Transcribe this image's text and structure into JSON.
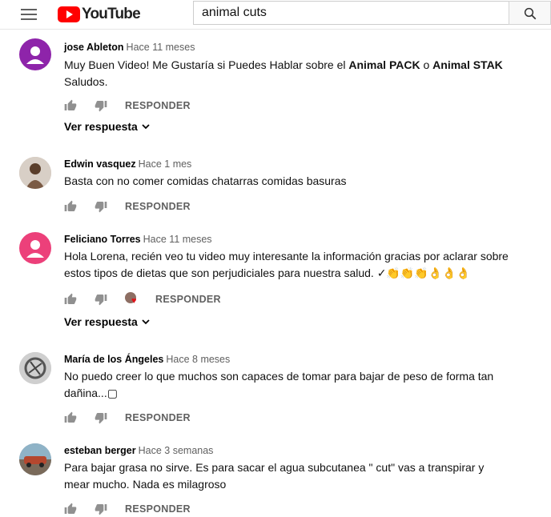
{
  "header": {
    "logo_text": "YouTube",
    "search_value": "animal cuts"
  },
  "colors": {
    "brand": "#ff0000",
    "reply_text": "#606060"
  },
  "comments": [
    {
      "author": "jose Ableton",
      "time": "Hace 11 meses",
      "text_before": "Muy Buen Video! Me Gustaría si Puedes Hablar sobre el ",
      "bold_1": "Animal PACK",
      "text_mid": " o ",
      "bold_2": "Animal STAK",
      "text_after": " Saludos.",
      "reply_label": "RESPONDER",
      "replies_label": "Ver respuesta"
    },
    {
      "author": "Edwin vasquez",
      "time": "Hace 1 mes",
      "text": "Basta con no comer comidas chatarras comidas basuras",
      "reply_label": "RESPONDER"
    },
    {
      "author": "Feliciano Torres",
      "time": "Hace 11 meses",
      "text": "Hola Lorena, recién veo tu video muy interesante la información gracias por aclarar sobre estos tipos de dietas que son perjudiciales para nuestra salud. ✓👏👏👏👌👌👌",
      "reply_label": "RESPONDER",
      "replies_label": "Ver respuesta"
    },
    {
      "author": "María de los Ángeles",
      "time": "Hace 8 meses",
      "text": "No puedo creer lo que muchos son capaces de tomar para bajar de peso de forma tan dañina...▢",
      "reply_label": "RESPONDER"
    },
    {
      "author": "esteban berger",
      "time": "Hace 3 semanas",
      "text": "Para bajar grasa no sirve. Es para sacar el agua subcutanea \" cut\" vas a transpirar y mear mucho.  Nada es milagroso",
      "reply_label": "RESPONDER"
    }
  ]
}
